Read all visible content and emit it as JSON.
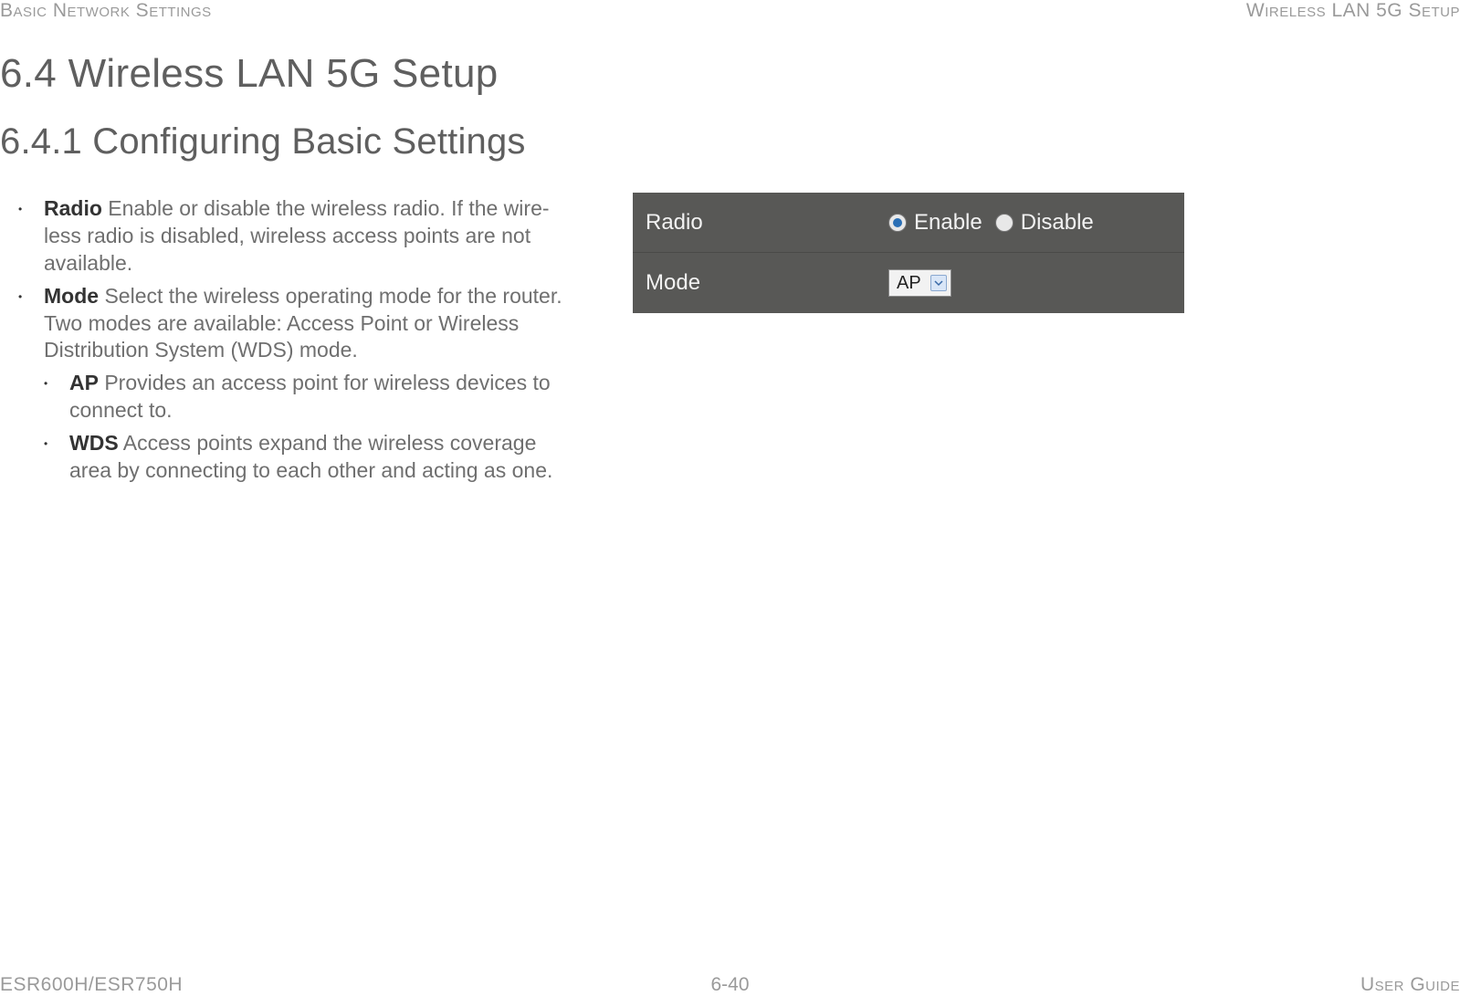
{
  "header": {
    "left": "Basic Network Settings",
    "right": "Wireless LAN 5G Setup"
  },
  "h1": "6.4 Wireless LAN 5G Setup",
  "h2": "6.4.1 Configuring Basic Settings",
  "bullets": {
    "radio": {
      "term": "Radio",
      "desc": "  Enable or disable the wireless radio. If the wire­less radio is disabled, wireless access points are not available."
    },
    "mode": {
      "term": "Mode",
      "desc": "  Select the wireless operating mode for the router. Two modes are available: Access Point or Wireless Distri­bution System (WDS) mode."
    },
    "ap": {
      "term": "AP",
      "desc": "  Provides an access point for wireless devices to connect to."
    },
    "wds": {
      "term": "WDS",
      "desc": "  Access points expand the wireless coverage area by connecting to each other and acting as one."
    }
  },
  "ui": {
    "radio_label": "Radio",
    "radio_enable": "Enable",
    "radio_disable": "Disable",
    "mode_label": "Mode",
    "mode_value": "AP"
  },
  "footer": {
    "left": "ESR600H/ESR750H",
    "center": "6-40",
    "right": "User Guide"
  }
}
